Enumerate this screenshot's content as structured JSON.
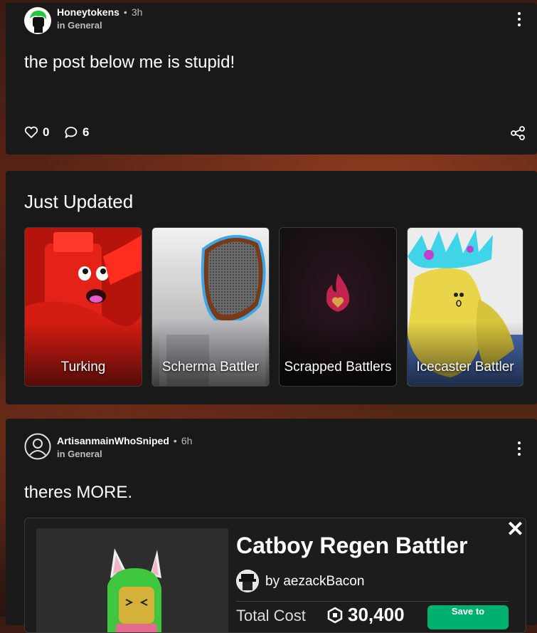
{
  "post1": {
    "author": "Honeytokens",
    "separator": "•",
    "time": "3h",
    "category": "in General",
    "text": "the post below me is stupid!",
    "likes": "0",
    "comments": "6",
    "avatar_icon": "green-hair-avatar-icon"
  },
  "just_updated": {
    "title": "Just Updated",
    "tiles": [
      {
        "label": "Turking"
      },
      {
        "label": "Scherma Battler"
      },
      {
        "label": "Scrapped Battlers"
      },
      {
        "label": "Icecaster Battler"
      }
    ]
  },
  "post2": {
    "author": "ArtisanmainWhoSniped",
    "separator": "•",
    "time": "6h",
    "category": "in General",
    "text": "theres MORE.",
    "embed": {
      "title": "Catboy Regen Battler",
      "by": "by aezackBacon",
      "cost_label": "Total Cost",
      "price": "30,400",
      "save_label": "Save to",
      "close": "✕"
    }
  },
  "colors": {
    "card_bg": "#191919",
    "accent_green": "#00b06f",
    "muted": "#bdbdbd"
  }
}
